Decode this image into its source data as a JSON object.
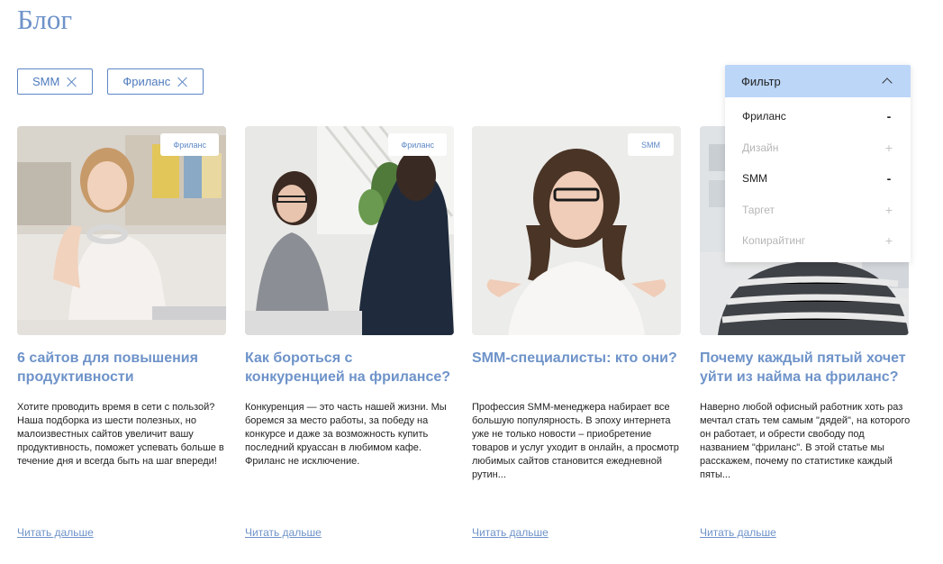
{
  "page": {
    "title": "Блог"
  },
  "active_tags": [
    {
      "label": "SMM"
    },
    {
      "label": "Фриланс"
    }
  ],
  "filter": {
    "label": "Фильтр",
    "items": [
      {
        "label": "Фриланс",
        "sign": "-"
      },
      {
        "label": "Дизайн",
        "sign": "+"
      },
      {
        "label": "SMM",
        "sign": "-"
      },
      {
        "label": "Таргет",
        "sign": "+"
      },
      {
        "label": "Копирайтинг",
        "sign": "+"
      }
    ]
  },
  "cards": [
    {
      "tag": "Фриланс",
      "title": "6 сайтов для повышения продуктивности",
      "text": "Хотите проводить время в сети с пользой? Наша подборка из шести полезных, но малоизвестных сайтов увеличит вашу продуктивность, поможет успевать больше в течение дня и всегда быть на шаг впереди!",
      "link": "Читать дальше"
    },
    {
      "tag": "Фриланс",
      "title": "Как бороться с конкуренцией на фрилансе?",
      "text": "Конкуренция — это часть нашей жизни. Мы боремся за место работы, за победу на конкурсе и даже за возможность купить последний круассан в любимом кафе. Фриланс не исключение.",
      "link": "Читать дальше"
    },
    {
      "tag": "SMM",
      "title": "SMM-специалисты: кто они?",
      "text": "Профессия SMM-менеджера набирает все большую популярность. В эпоху интернета уже не только новости – приобретение товаров и услуг уходит в онлайн, а просмотр любимых сайтов становится ежедневной рутин...",
      "link": "Читать дальше"
    },
    {
      "tag": "",
      "title": "Почему каждый пятый хочет уйти из найма на фриланс?",
      "text": "Наверно любой офисный работник хоть раз мечтал стать тем самым \"дядей\", на которого он работает, и обрести свободу под названием \"фриланс\". В этой статье мы расскажем, почему по статистике каждый пяты...",
      "link": "Читать дальше"
    }
  ]
}
